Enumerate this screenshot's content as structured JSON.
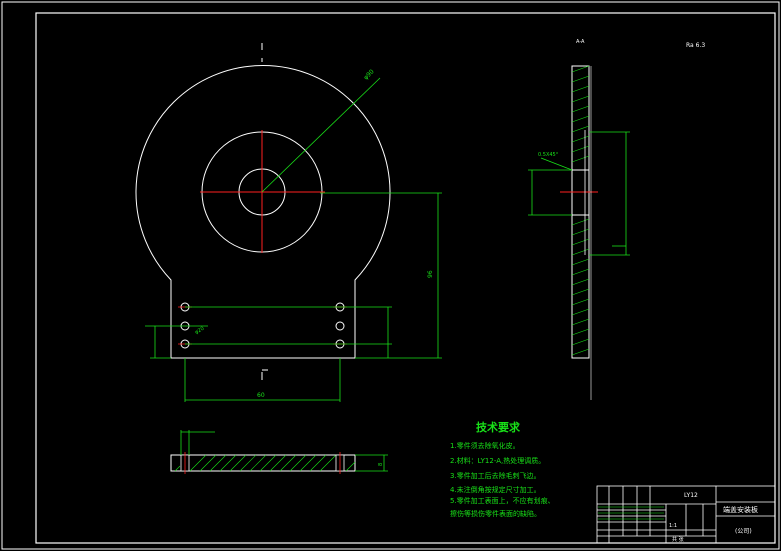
{
  "colors": {
    "background": "#000000",
    "outline": "#ffffff",
    "dimension": "#18e018",
    "centerline": "#ff2020",
    "hatch": "#18e018"
  },
  "notes": {
    "title": "技术要求",
    "items": [
      "1.零件须去除氧化皮。",
      "2.材料：LY12-A,热处理调质。",
      "3.零件加工后去除毛刺飞边。",
      "4.未注倒角按规定尺寸加工。",
      "5.零件加工表面上，不应有划痕、",
      "擦伤等损伤零件表面的缺陷。"
    ]
  },
  "title_block": {
    "part_name": "端盖安装板",
    "material": "LY12",
    "company": "(公司)",
    "scale": "1:1",
    "sheet": "共 张"
  },
  "dimensions": {
    "d_large": "φ90",
    "d_hole": "φ20",
    "height": "96",
    "width": "60",
    "plate_thk": "8",
    "chamfer": "0.5X45°",
    "surface_finish": "Ra 6.3",
    "section_label": "A-A"
  }
}
